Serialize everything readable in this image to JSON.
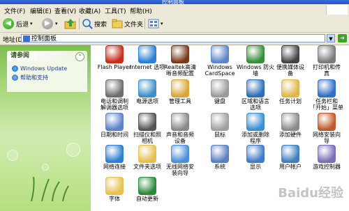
{
  "window": {
    "title": "控制面板"
  },
  "menu": [
    "文件(F)",
    "编辑(E)",
    "查看(V)",
    "收藏(A)",
    "工具(T)",
    "帮助(H)"
  ],
  "toolbar": {
    "back": "后退",
    "search": "搜索",
    "folders": "文件夹"
  },
  "address": {
    "label": "地址(D)",
    "value": "控制面板"
  },
  "sidebar": {
    "panel_title": "请参阅",
    "links": [
      {
        "label": "Windows Update",
        "icon": "windows-update-icon"
      },
      {
        "label": "帮助和支持",
        "icon": "help-icon"
      }
    ]
  },
  "items": [
    {
      "label": "Flash Player",
      "icon": "flash-player-icon",
      "color": "#c72c1c"
    },
    {
      "label": "Internet 选项",
      "icon": "internet-options-icon",
      "color": "#2c7fd3"
    },
    {
      "label": "Realtek高清\n晰音频配置",
      "icon": "realtek-audio-icon",
      "color": "#7a3a1a"
    },
    {
      "label": "Windows\nCardSpace",
      "icon": "cardspace-icon",
      "color": "#5f86c8"
    },
    {
      "label": "Windows 防火\n墙",
      "icon": "firewall-icon",
      "color": "#3a8d3a"
    },
    {
      "label": "便携媒体设\n备",
      "icon": "portable-media-icon",
      "color": "#444444"
    },
    {
      "label": "打印机和传\n真",
      "icon": "printer-fax-icon",
      "color": "#7b7b7b"
    },
    {
      "label": "电话和调制\n解调器选项",
      "icon": "phone-modem-icon",
      "color": "#6e6e6e"
    },
    {
      "label": "电源选项",
      "icon": "power-options-icon",
      "color": "#3f8fc7"
    },
    {
      "label": "管理工具",
      "icon": "admin-tools-icon",
      "color": "#d8a63a"
    },
    {
      "label": "键盘",
      "icon": "keyboard-icon",
      "color": "#9b9b9b"
    },
    {
      "label": "区域和语言\n选项",
      "icon": "region-language-icon",
      "color": "#2f6fb8"
    },
    {
      "label": "任务计划",
      "icon": "scheduled-tasks-icon",
      "color": "#e1b64a"
    },
    {
      "label": "任务栏和\n「开始」菜单",
      "icon": "taskbar-start-icon",
      "color": "#2e6fc7"
    },
    {
      "label": "日期和时间",
      "icon": "date-time-icon",
      "color": "#5a83c9"
    },
    {
      "label": "扫描仪和照\n相机",
      "icon": "scanner-camera-icon",
      "color": "#555555"
    },
    {
      "label": "声音和音频\n设备",
      "icon": "sound-audio-icon",
      "color": "#8a8a8a"
    },
    {
      "label": "鼠标",
      "icon": "mouse-icon",
      "color": "#a0a0a0"
    },
    {
      "label": "添加或删除\n程序",
      "icon": "add-remove-programs-icon",
      "color": "#3b8fd0"
    },
    {
      "label": "添加硬件",
      "icon": "add-hardware-icon",
      "color": "#8c8c8c"
    },
    {
      "label": "网络安装向\n导",
      "icon": "network-setup-icon",
      "color": "#c05a2a"
    },
    {
      "label": "网络连接",
      "icon": "network-connections-icon",
      "color": "#2c7fd3"
    },
    {
      "label": "文件夹选项",
      "icon": "folder-options-icon",
      "color": "#e4c04e"
    },
    {
      "label": "无线网络安\n装向导",
      "icon": "wireless-setup-icon",
      "color": "#4a8fd8"
    },
    {
      "label": "系统",
      "icon": "system-icon",
      "color": "#5b7fc0"
    },
    {
      "label": "显示",
      "icon": "display-icon",
      "color": "#3f7bc9"
    },
    {
      "label": "用户帐户",
      "icon": "user-accounts-icon",
      "color": "#3f7fbd"
    },
    {
      "label": "游戏控制器",
      "icon": "game-controller-icon",
      "color": "#7a6fb8"
    },
    {
      "label": "字体",
      "icon": "fonts-icon",
      "color": "#e6c24c"
    },
    {
      "label": "自动更新",
      "icon": "automatic-updates-icon",
      "color": "#2a8a3a"
    }
  ]
}
